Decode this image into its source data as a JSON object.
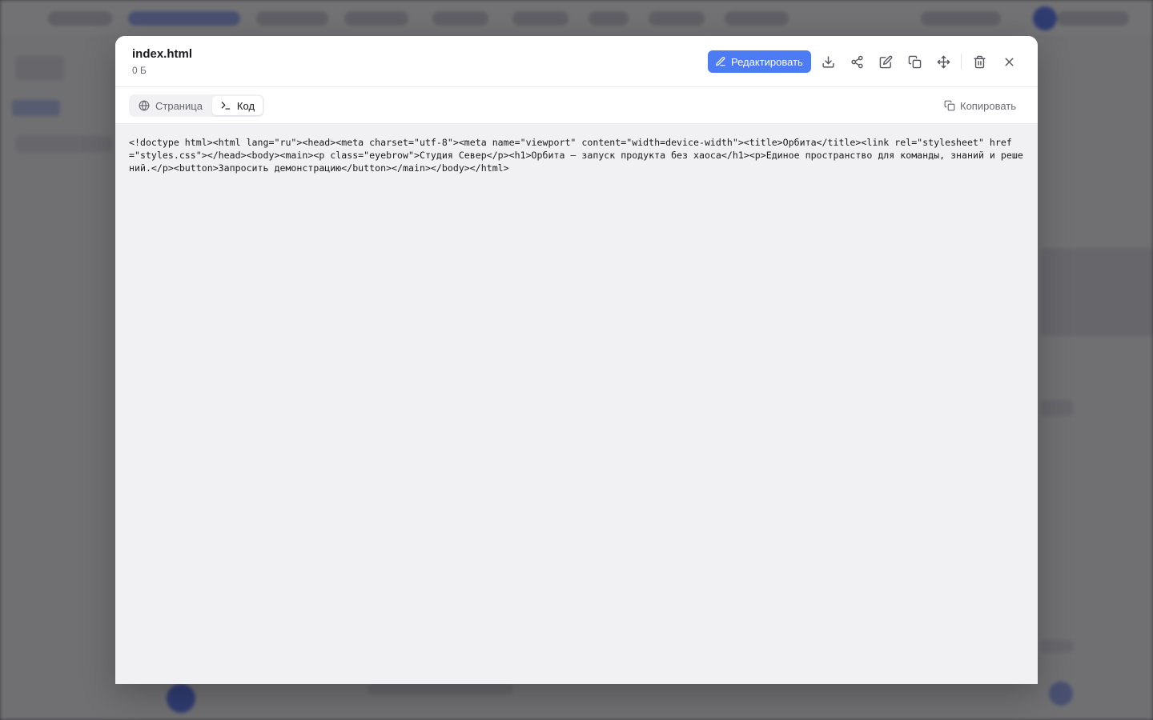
{
  "file": {
    "name": "index.html",
    "size": "0 Б"
  },
  "toolbar": {
    "edit_label": "Редактировать",
    "icons": [
      "download-icon",
      "share-icon",
      "edit-icon",
      "duplicate-icon",
      "move-icon",
      "trash-icon",
      "close-icon"
    ]
  },
  "tabs": [
    {
      "label": "Страница",
      "icon": "globe-icon",
      "active": false
    },
    {
      "label": "Код",
      "icon": "terminal-icon",
      "active": true
    }
  ],
  "copy_label": "Копировать",
  "code": "<!doctype html><html lang=\"ru\"><head><meta charset=\"utf-8\"><meta name=\"viewport\" content=\"width=device-width\"><title>Орбита</title><link rel=\"stylesheet\" href=\"styles.css\"></head><body><main><p class=\"eyebrow\">Студия Север</p><h1>Орбита — запуск продукта без хаоса</h1><p>Единое пространство для команды, знаний и решений.</p><button>Запросить демонстрацию</button></main></body></html>",
  "colors": {
    "accent": "#4c7bf4",
    "code_background": "#f1f1f4",
    "scrim": "#5f5f62"
  }
}
